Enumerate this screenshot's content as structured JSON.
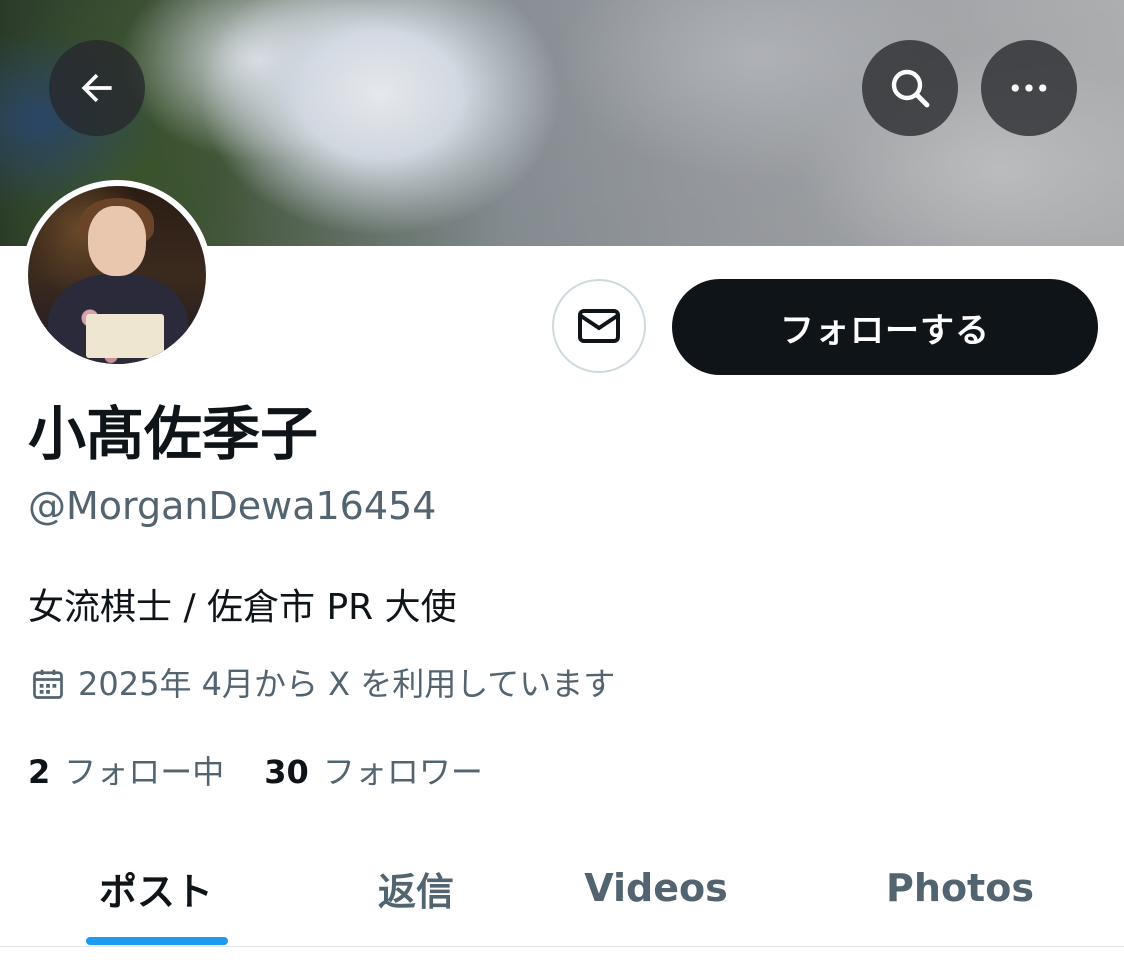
{
  "header": {
    "back_icon": "arrow-left-icon",
    "search_icon": "search-icon",
    "more_icon": "more-horizontal-icon"
  },
  "profile": {
    "display_name": "小髙佐季子",
    "handle": "@MorganDewa16454",
    "bio": "女流棋士 / 佐倉市 PR 大使",
    "joined": "2025年 4月から X を利用しています",
    "following_count": "2",
    "following_label": "フォロー中",
    "followers_count": "30",
    "followers_label": "フォロワー"
  },
  "actions": {
    "message_icon": "mail-icon",
    "follow_label": "フォローする"
  },
  "tabs": [
    {
      "label": "ポスト",
      "active": true
    },
    {
      "label": "返信",
      "active": false
    },
    {
      "label": "Videos",
      "active": false
    },
    {
      "label": "Photos",
      "active": false
    }
  ],
  "colors": {
    "primary_text": "#0f1419",
    "secondary_text": "#536471",
    "accent": "#1d9bf0",
    "follow_button_bg": "#0f1419"
  }
}
